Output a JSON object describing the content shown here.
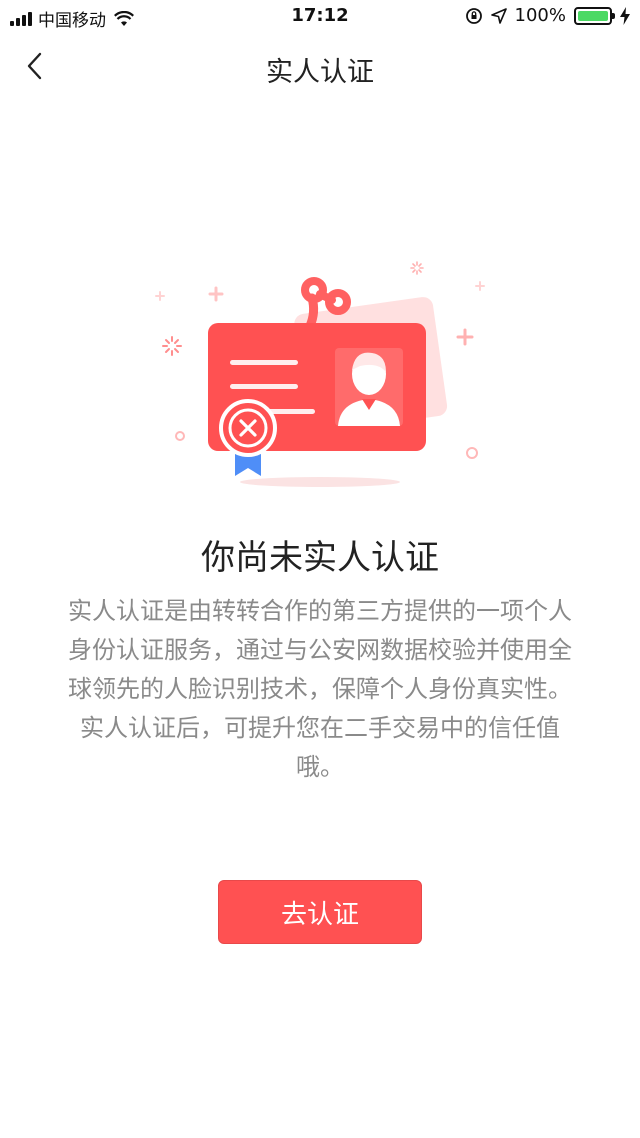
{
  "status_bar": {
    "carrier": "中国移动",
    "time": "17:12",
    "battery": "100%",
    "battery_level": 1.0,
    "battery_color": "#4cd964"
  },
  "nav": {
    "back_icon": "chevron-left-icon",
    "title": "实人认证"
  },
  "illustration": {
    "icon": "id-card-unverified-icon",
    "card_color": "#ff5152",
    "badge_ribbon_color": "#4f8ef7"
  },
  "main": {
    "headline": "你尚未实人认证",
    "description": "实人认证是由转转合作的第三方提供的一项个人身份认证服务，通过与公安网数据校验并使用全球领先的人脸识别技术，保障个人身份真实性。实人认证后，可提升您在二手交易中的信任值哦。"
  },
  "actions": {
    "verify_label": "去认证",
    "accent_color": "#ff5152"
  }
}
